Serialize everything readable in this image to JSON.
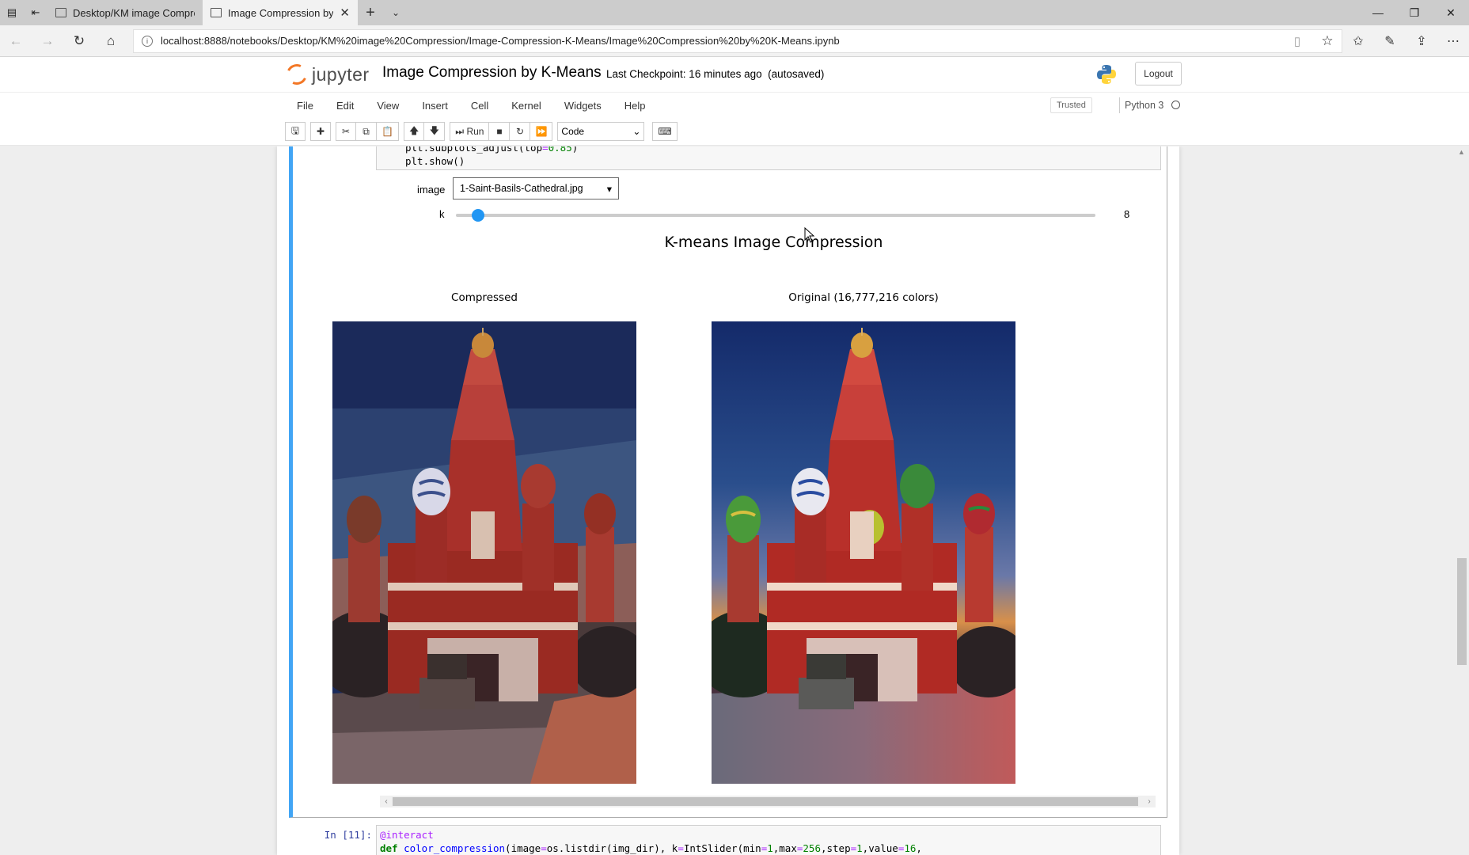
{
  "browser": {
    "tabs": [
      {
        "title": "Desktop/KM image Compre",
        "active": false
      },
      {
        "title": "Image Compression by",
        "active": true
      }
    ],
    "url": "localhost:8888/notebooks/Desktop/KM%20image%20Compression/Image-Compression-K-Means/Image%20Compression%20by%20K-Means.ipynb"
  },
  "jupyter": {
    "logo_text": "jupyter",
    "notebook_title": "Image Compression by K-Means",
    "checkpoint": "Last Checkpoint: 16 minutes ago",
    "autosaved": "(autosaved)",
    "logout_label": "Logout",
    "menu": [
      "File",
      "Edit",
      "View",
      "Insert",
      "Cell",
      "Kernel",
      "Widgets",
      "Help"
    ],
    "trusted_label": "Trusted",
    "kernel_name": "Python 3",
    "toolbar": {
      "run_label": "Run",
      "cell_type": "Code"
    }
  },
  "cell": {
    "code_tail": [
      "plt.subplots_adjust(top=0.85)",
      "plt.show()"
    ],
    "widget_image_label": "image",
    "widget_image_value": "1-Saint-Basils-Cathedral.jpg",
    "widget_k_label": "k",
    "widget_k_value": "8",
    "slider": {
      "min": 1,
      "max": 256,
      "value": 8
    },
    "figure_title": "K-means Image Compression",
    "left_title": "Compressed",
    "right_title": "Original (16,777,216 colors)"
  },
  "next_cell": {
    "prompt": "In [11]:",
    "line1": "@interact",
    "line2_parts": [
      "def",
      " ",
      "color_compression",
      "(image",
      "=",
      "os.listdir(img_dir), k",
      "=",
      "IntSlider(min",
      "=",
      "1",
      ",max",
      "=",
      "256",
      ",step",
      "=",
      "1",
      ",value",
      "=",
      "16",
      ","
    ]
  },
  "colors": {
    "accent_blue": "#42a5f5",
    "slider_thumb": "#2196f3",
    "jupyter_orange": "#f37726"
  }
}
